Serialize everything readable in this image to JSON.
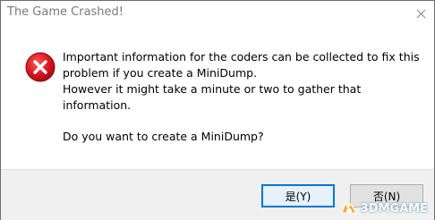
{
  "window": {
    "title": "The Game Crashed!"
  },
  "message": {
    "lines": [
      "Important information for the coders can be collected to fix this",
      "problem if you create a MiniDump.",
      "However it might take a minute or two to gather that",
      "information."
    ],
    "question": "Do you want to create a MiniDump?"
  },
  "buttons": {
    "yes_label": "是(Y)",
    "no_label": "否(N)"
  },
  "watermark": {
    "text": "3DMGAME"
  },
  "colors": {
    "error_red": "#e81123",
    "focus_border": "#0078d7"
  },
  "icons": {
    "error": "error-icon",
    "close": "close-icon"
  }
}
